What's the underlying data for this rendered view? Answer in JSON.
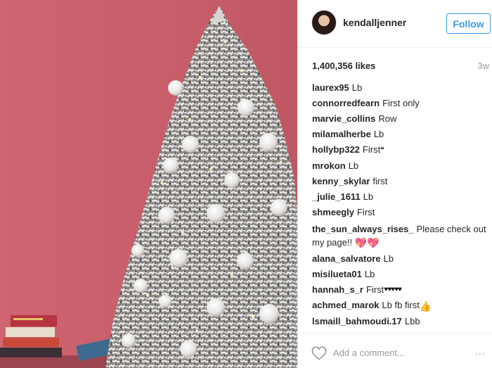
{
  "post": {
    "image_alt": "Frosted Christmas tree with white ornaments against a pink wall",
    "username": "kendalljenner",
    "follow_label": "Follow",
    "likes": "1,400,356 likes",
    "time_ago": "3w"
  },
  "comments": [
    {
      "user": "laurex95",
      "text": "Lb"
    },
    {
      "user": "connorredfearn",
      "text": "First only"
    },
    {
      "user": "marvie_collins",
      "text": "Row"
    },
    {
      "user": "milamalherbe",
      "text": "Lb"
    },
    {
      "user": "hollybp322",
      "text": "First"
    },
    {
      "user": "mrokon",
      "text": "Lb"
    },
    {
      "user": "kenny_skylar",
      "text": "first"
    },
    {
      "user": "_julie_1611",
      "text": "Lb"
    },
    {
      "user": "shmeegly",
      "text": "First"
    },
    {
      "user": "the_sun_always_rises_",
      "text": "Please check out my page!!"
    },
    {
      "user": "alana_salvatore",
      "text": "Lb"
    },
    {
      "user": "misilueta01",
      "text": "Lb"
    },
    {
      "user": "hannah_s_r",
      "text": "First"
    },
    {
      "user": "achmed_marok",
      "text": "Lb fb first"
    },
    {
      "user": "lsmaill_bahmoudi.17",
      "text": "Lbb"
    }
  ],
  "emoji": {
    "hollybp322": "❝",
    "the_sun_always_rises_": "💖💖",
    "hannah_s_r": "♥♥♥♥♥",
    "achmed_marok": "👍"
  },
  "footer": {
    "comment_placeholder": "Add a comment...",
    "more_label": "..."
  },
  "icons": {
    "like": "heart-outline-icon",
    "more": "more-options-icon"
  },
  "colors": {
    "accent": "#3897f0",
    "wall": "#c85e6a",
    "text": "#262626",
    "muted": "#999999"
  }
}
